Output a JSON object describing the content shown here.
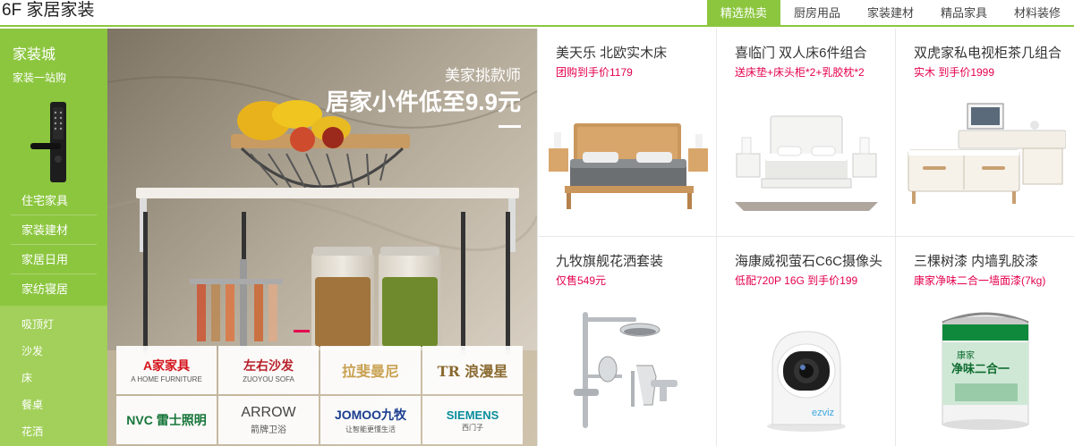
{
  "header": {
    "floor_title": "6F 家居家装",
    "tabs": [
      {
        "label": "精选热卖",
        "active": true
      },
      {
        "label": "厨房用品",
        "active": false
      },
      {
        "label": "家装建材",
        "active": false
      },
      {
        "label": "精品家具",
        "active": false
      },
      {
        "label": "材料装修",
        "active": false
      }
    ]
  },
  "sidebar": {
    "title": "家装城",
    "subtitle": "家装一站购",
    "categories": [
      "住宅家具",
      "家装建材",
      "家居日用",
      "家纺寝居"
    ],
    "sub_items": [
      "吸顶灯",
      "沙发",
      "床",
      "餐桌",
      "花洒"
    ]
  },
  "hero": {
    "subtitle": "美家挑款师",
    "title": "居家小件低至9.9元"
  },
  "brands": [
    {
      "name": "A家家具",
      "small": "A HOME FURNITURE",
      "color": "#d4141c"
    },
    {
      "name": "左右沙发",
      "small": "ZUOYOU SOFA",
      "color": "#b8202a"
    },
    {
      "name": "拉斐曼尼",
      "small": "",
      "color": "#c8a050"
    },
    {
      "name": "TR 浪漫星",
      "small": "",
      "color": "#8a6a30"
    },
    {
      "name": "NVC 雷士照明",
      "small": "",
      "color": "#16753a"
    },
    {
      "name": "ARROW",
      "small": "箭牌卫浴",
      "color": "#444444"
    },
    {
      "name": "JOMOO九牧",
      "small": "让智能更懂生活",
      "color": "#1a3d8f"
    },
    {
      "name": "SIEMENS",
      "small": "西门子",
      "color": "#0a8d9c"
    }
  ],
  "products": [
    {
      "name": "美天乐 北欧实木床",
      "promo": "团购到手价1179",
      "icon": "wood-bed-icon"
    },
    {
      "name": "喜临门 双人床6件组合",
      "promo": "送床垫+床头柜*2+乳胶枕*2",
      "icon": "white-bed-set-icon"
    },
    {
      "name": "双虎家私电视柜茶几组合",
      "promo": "实木  到手价1999",
      "icon": "tv-cabinet-icon"
    },
    {
      "name": "九牧旗舰花洒套装",
      "promo": "仅售549元",
      "icon": "shower-set-icon"
    },
    {
      "name": "海康威视萤石C6C摄像头",
      "promo": "低配720P 16G 到手价199",
      "icon": "camera-icon",
      "brand_mark": "ezviz"
    },
    {
      "name": "三棵树漆 内墙乳胶漆",
      "promo": "康家净味二合一墙面漆(7kg)",
      "icon": "paint-bucket-icon",
      "paint_label": "康家",
      "paint_title": "净味二合一"
    }
  ],
  "colors": {
    "accent_green": "#8cc63f",
    "promo_pink": "#e4004f"
  }
}
